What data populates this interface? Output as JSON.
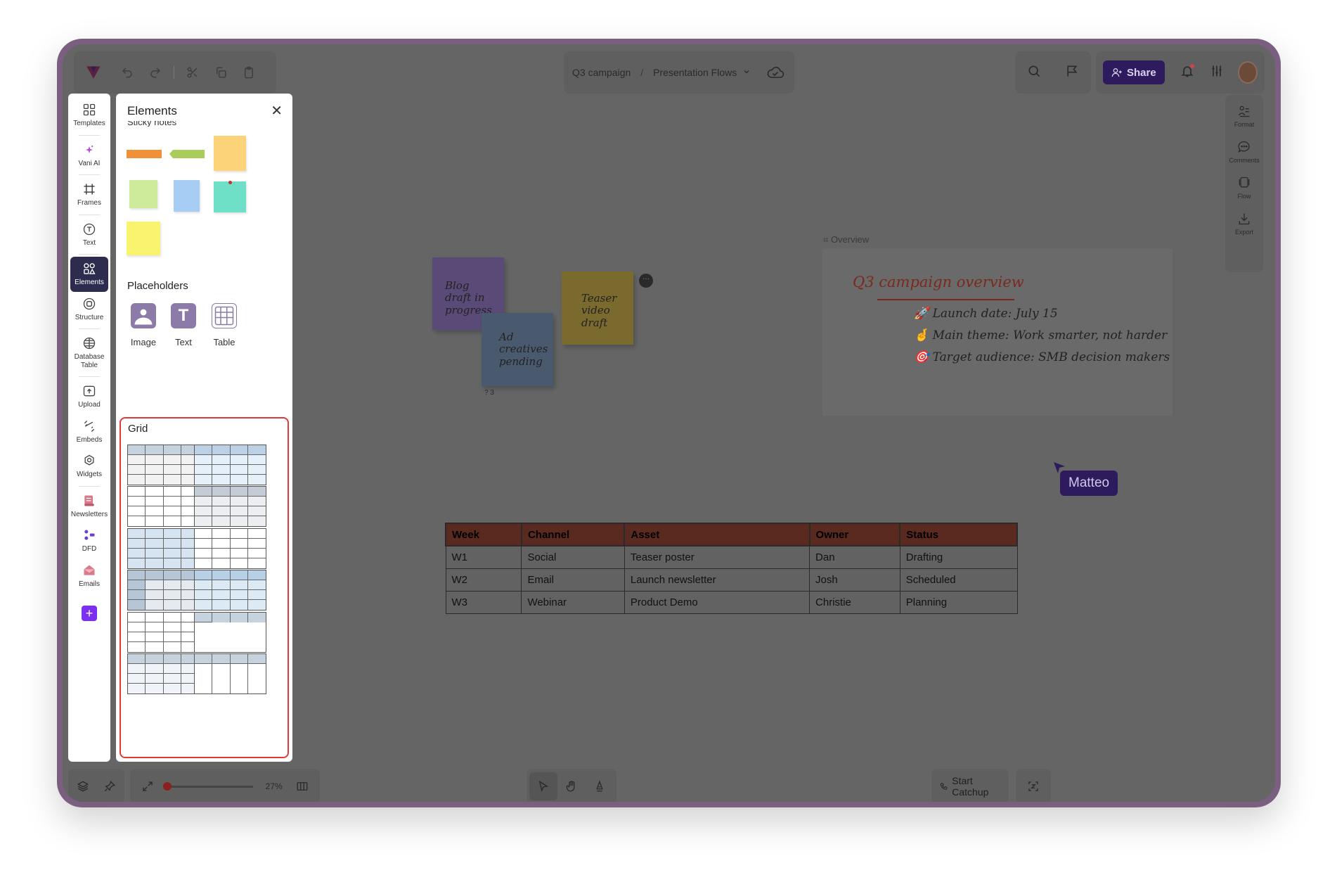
{
  "toolbar": {
    "breadcrumb_project": "Q3 campaign",
    "breadcrumb_page": "Presentation Flows",
    "share_label": "Share"
  },
  "left_rail": {
    "items": [
      {
        "label": "Templates",
        "icon": "templates-icon"
      },
      {
        "label": "Vani AI",
        "icon": "sparkle-icon"
      },
      {
        "label": "Frames",
        "icon": "frame-icon"
      },
      {
        "label": "Text",
        "icon": "text-icon"
      },
      {
        "label": "Elements",
        "icon": "elements-icon",
        "active": true
      },
      {
        "label": "Structure",
        "icon": "structure-icon"
      },
      {
        "label": "Database Table",
        "icon": "database-icon"
      },
      {
        "label": "Upload",
        "icon": "upload-icon"
      },
      {
        "label": "Embeds",
        "icon": "embed-icon"
      },
      {
        "label": "Widgets",
        "icon": "widgets-icon"
      },
      {
        "label": "Newsletters",
        "icon": "newsletter-icon"
      },
      {
        "label": "DFD",
        "icon": "dfd-icon"
      },
      {
        "label": "Emails",
        "icon": "email-icon"
      }
    ]
  },
  "elements_panel": {
    "title": "Elements",
    "clipped_section": "Sticky notes",
    "placeholders_label": "Placeholders",
    "placeholders": [
      {
        "label": "Image",
        "icon": "image-placeholder-icon"
      },
      {
        "label": "Text",
        "icon": "text-placeholder-icon"
      },
      {
        "label": "Table",
        "icon": "table-placeholder-icon"
      }
    ],
    "grid_label": "Grid"
  },
  "right_rail": {
    "items": [
      {
        "label": "Format",
        "icon": "format-icon"
      },
      {
        "label": "Comments",
        "icon": "comment-icon"
      },
      {
        "label": "Flow",
        "icon": "flow-icon"
      },
      {
        "label": "Export",
        "icon": "export-icon"
      }
    ]
  },
  "canvas": {
    "stickies": [
      {
        "text": "Blog draft in progress",
        "color": "#5a4a78"
      },
      {
        "text": "Ad creatives pending",
        "color": "#4a5a6e"
      },
      {
        "text": "Teaser video draft",
        "color": "#7a6a2e"
      }
    ],
    "sticky_reaction": "? 3",
    "overview": {
      "frame_label": "Overview",
      "title": "Q3 campaign overview",
      "lines": [
        {
          "emoji": "🚀",
          "text": "Launch date: July 15"
        },
        {
          "emoji": "🤞",
          "text": "Main theme: Work smarter, not harder"
        },
        {
          "emoji": "🎯",
          "text": "Target audience: SMB decision makers"
        }
      ]
    },
    "cursor_user": "Matteo",
    "table": {
      "headers": [
        "Week",
        "Channel",
        "Asset",
        "Owner",
        "Status"
      ],
      "rows": [
        [
          "W1",
          "Social",
          "Teaser poster",
          "Dan",
          "Drafting"
        ],
        [
          "W2",
          "Email",
          "Launch newsletter",
          "Josh",
          "Scheduled"
        ],
        [
          "W3",
          "Webinar",
          "Product Demo",
          "Christie",
          "Planning"
        ]
      ]
    }
  },
  "bottom_bar": {
    "zoom_label": "27%",
    "zoom_level": 0.27,
    "catchup_label": "Start Catchup"
  },
  "colors": {
    "accent": "#2d1b5e",
    "grid_highlight": "#e03a3a",
    "add_button": "#7b2ff0"
  }
}
